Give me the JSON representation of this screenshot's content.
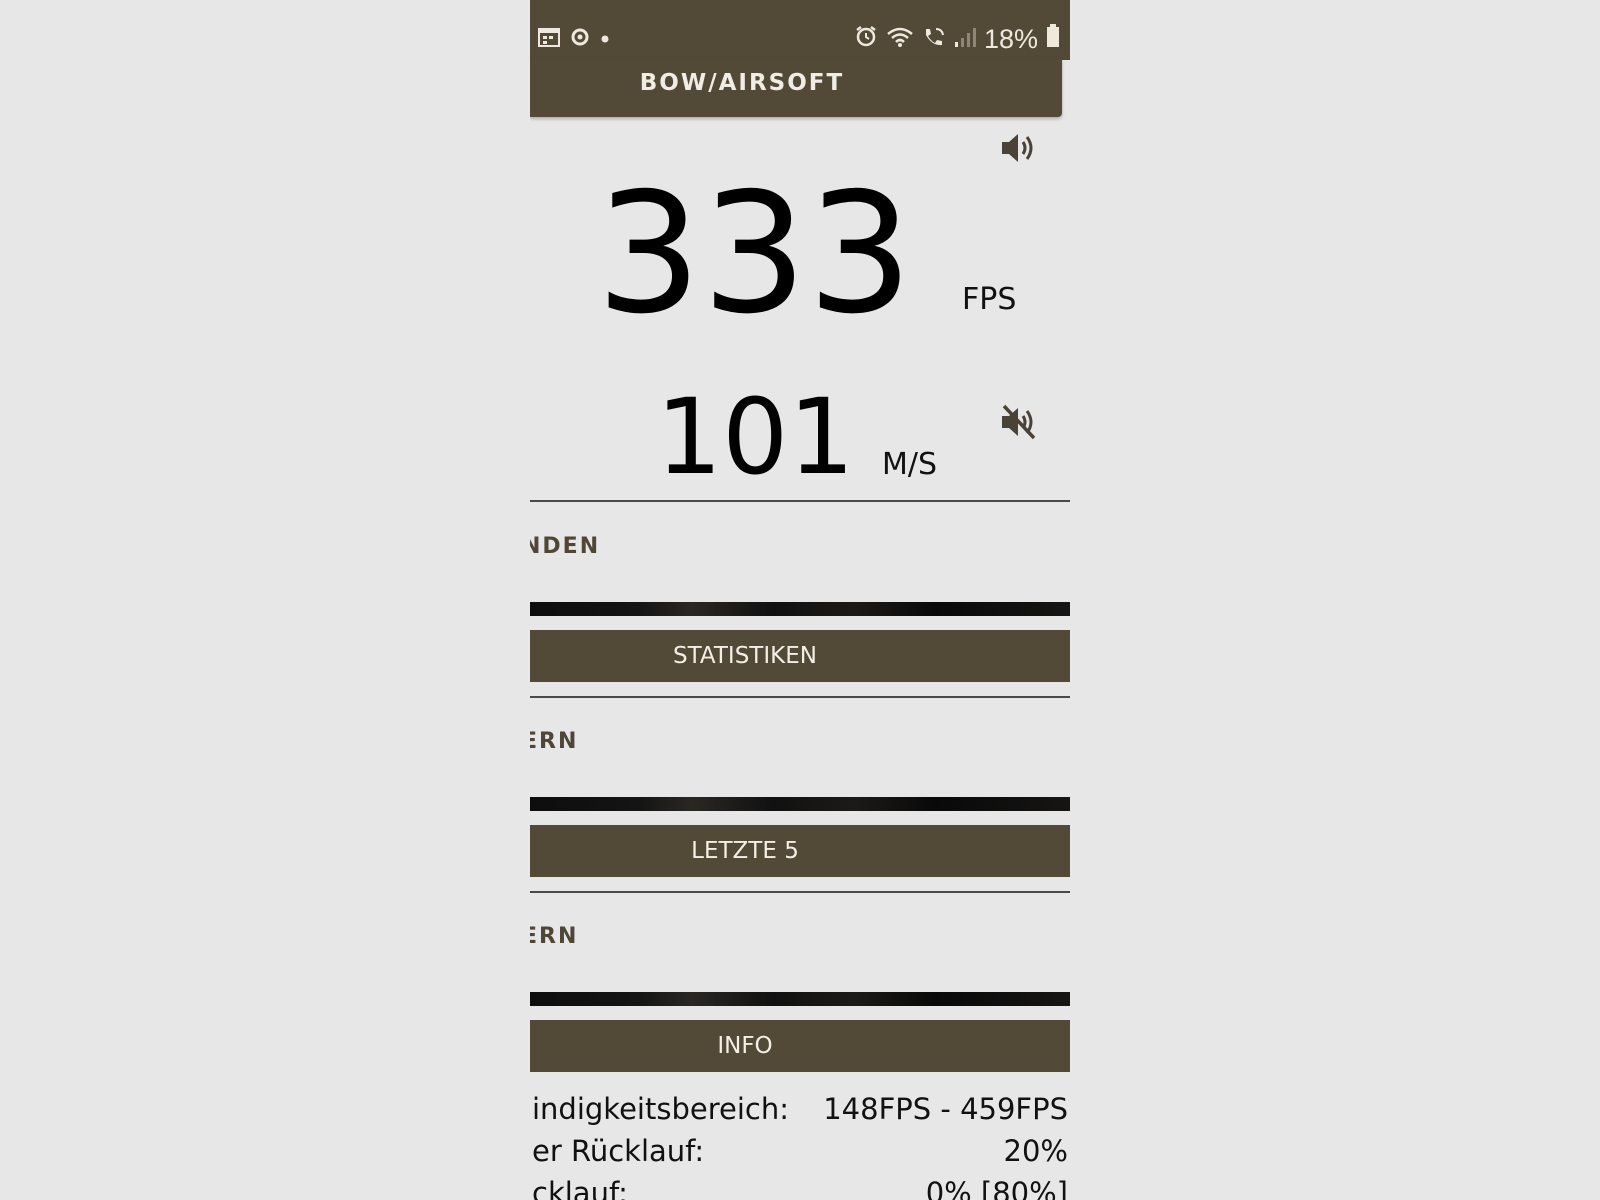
{
  "status_bar": {
    "battery_percent": "18%",
    "icons": [
      "calendar-icon",
      "sync-icon",
      "notification-dot-icon",
      "alarm-icon",
      "wifi-icon",
      "wifi-calling-icon",
      "signal-icon",
      "battery-icon"
    ]
  },
  "app_bar": {
    "title": "BOW/AIRSOFT"
  },
  "readings": {
    "fps_value": "333",
    "fps_unit": "FPS",
    "fps_sound_icon": "speaker-on-icon",
    "ms_value": "101",
    "ms_unit": "M/S",
    "ms_sound_icon": "speaker-muted-icon"
  },
  "sections": [
    {
      "label": "NDEN",
      "button": "STATISTIKEN"
    },
    {
      "label": "ERN",
      "button": "LETZTE 5"
    },
    {
      "label": "ERN",
      "button": "INFO"
    }
  ],
  "info": {
    "rows": [
      {
        "label": "indigkeitsbereich:",
        "value": "148FPS - 459FPS"
      },
      {
        "label": "er Rücklauf:",
        "value": "20%"
      },
      {
        "label": "cklauf:",
        "value": "0%  [80%]"
      }
    ]
  },
  "colors": {
    "brand": "#524937",
    "background": "#e7e7e7"
  }
}
